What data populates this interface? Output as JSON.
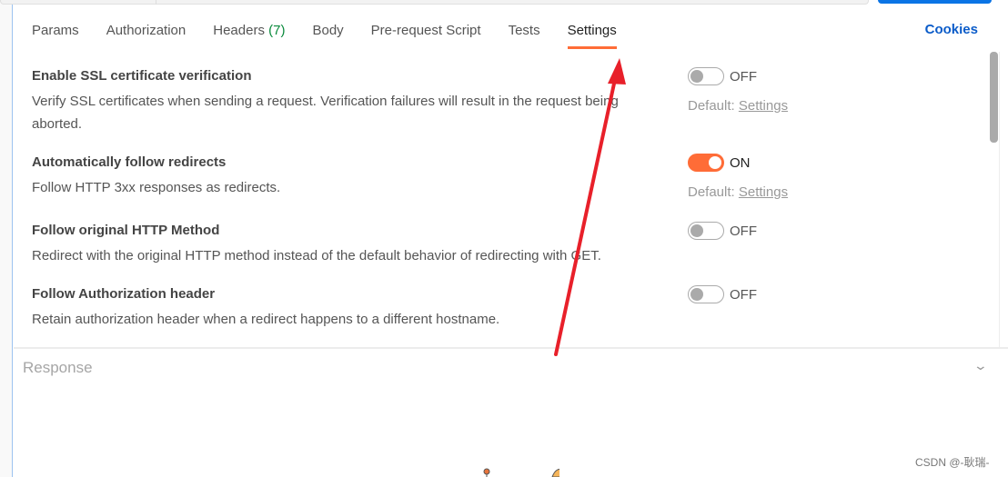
{
  "tabs": [
    {
      "label": "Params"
    },
    {
      "label": "Authorization"
    },
    {
      "label": "Headers",
      "count": "(7)"
    },
    {
      "label": "Body"
    },
    {
      "label": "Pre-request Script"
    },
    {
      "label": "Tests"
    },
    {
      "label": "Settings",
      "active": true
    }
  ],
  "cookies": "Cookies",
  "settings": [
    {
      "title": "Enable SSL certificate verification",
      "desc": "Verify SSL certificates when sending a request. Verification failures will result in the request being aborted.",
      "state": "OFF",
      "on": false,
      "default_label": "Default:",
      "default_link": "Settings"
    },
    {
      "title": "Automatically follow redirects",
      "desc": "Follow HTTP 3xx responses as redirects.",
      "state": "ON",
      "on": true,
      "default_label": "Default:",
      "default_link": "Settings"
    },
    {
      "title": "Follow original HTTP Method",
      "desc": "Redirect with the original HTTP method instead of the default behavior of redirecting with GET.",
      "state": "OFF",
      "on": false
    },
    {
      "title": "Follow Authorization header",
      "desc": "Retain authorization header when a redirect happens to a different hostname.",
      "state": "OFF",
      "on": false
    }
  ],
  "response": {
    "title": "Response"
  },
  "watermark": "CSDN @-耿瑞-",
  "colors": {
    "accent": "#ff6c37",
    "link": "#0b5cc9",
    "annotation_arrow": "#e8202a"
  }
}
